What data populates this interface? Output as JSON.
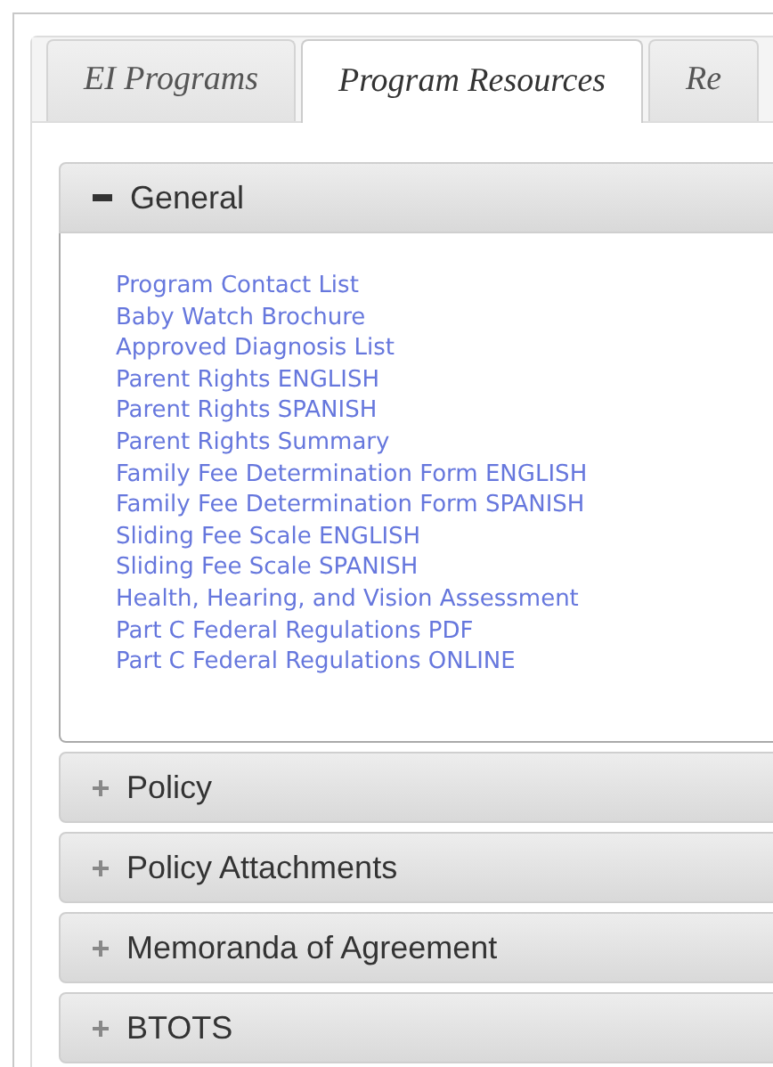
{
  "tabs": [
    {
      "label": "EI Programs",
      "selected": false
    },
    {
      "label": "Program Resources",
      "selected": true
    },
    {
      "label": "Re",
      "selected": false
    }
  ],
  "sections": [
    {
      "title": "General",
      "expanded": true,
      "links": [
        "Program Contact List",
        "Baby Watch Brochure",
        "Approved Diagnosis List",
        "Parent Rights ENGLISH",
        "Parent Rights SPANISH",
        "Parent Rights Summary",
        "Family Fee Determination Form ENGLISH",
        "Family Fee Determination Form SPANISH",
        "Sliding Fee Scale ENGLISH",
        "Sliding Fee Scale SPANISH",
        "Health, Hearing, and Vision Assessment",
        "Part C Federal Regulations PDF",
        "Part C Federal Regulations ONLINE"
      ]
    },
    {
      "title": "Policy",
      "expanded": false
    },
    {
      "title": "Policy Attachments",
      "expanded": false
    },
    {
      "title": "Memoranda of Agreement",
      "expanded": false
    },
    {
      "title": "BTOTS",
      "expanded": false
    }
  ]
}
